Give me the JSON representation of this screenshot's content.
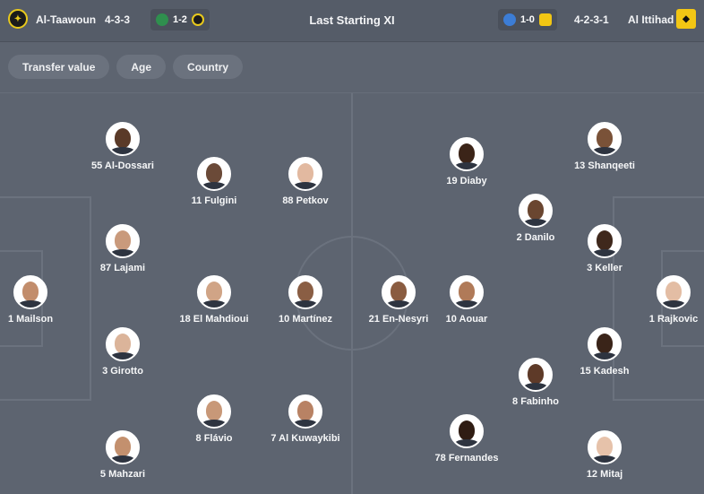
{
  "header": {
    "home_team": "Al-Taawoun",
    "home_formation": "4-3-3",
    "home_result": "1-2",
    "title": "Last Starting XI",
    "away_result": "1-0",
    "away_formation": "4-2-3-1",
    "away_team": "Al Ittihad"
  },
  "filters": [
    "Transfer value",
    "Age",
    "Country"
  ],
  "home_players": [
    {
      "label": "55 Al-Dossari",
      "skin": "#5a3a28"
    },
    {
      "label": "11 Fulgini",
      "skin": "#6b4a38"
    },
    {
      "label": "88 Petkov",
      "skin": "#e2b9a0"
    },
    {
      "label": "87 Lajami",
      "skin": "#c99a7c"
    },
    {
      "label": "1 Mailson",
      "skin": "#c28d6c"
    },
    {
      "label": "18 El Mahdioui",
      "skin": "#d0a486"
    },
    {
      "label": "10 Martínez",
      "skin": "#8a5e44"
    },
    {
      "label": "3 Girotto",
      "skin": "#dbb49a"
    },
    {
      "label": "8 Flávio",
      "skin": "#c89878"
    },
    {
      "label": "7 Al Kuwaykibi",
      "skin": "#b88264"
    },
    {
      "label": "5 Mahzari",
      "skin": "#c3906e"
    }
  ],
  "away_players": [
    {
      "label": "19 Diaby",
      "skin": "#3b2418"
    },
    {
      "label": "13 Shanqeeti",
      "skin": "#7a5238"
    },
    {
      "label": "2 Danilo",
      "skin": "#6a4630"
    },
    {
      "label": "3 Keller",
      "skin": "#3f281c"
    },
    {
      "label": "21 En-Nesyri",
      "skin": "#8a5c40"
    },
    {
      "label": "10 Aouar",
      "skin": "#b07a58"
    },
    {
      "label": "1 Rajkovic",
      "skin": "#e3bda4"
    },
    {
      "label": "15 Kadesh",
      "skin": "#3a2419"
    },
    {
      "label": "8 Fabinho",
      "skin": "#5e3a28"
    },
    {
      "label": "78 Fernandes",
      "skin": "#2f1c13"
    },
    {
      "label": "12 Mitaj",
      "skin": "#e6c2aa"
    }
  ],
  "colors": {
    "background": "#5d6470",
    "chip": "#6b727e",
    "pitch_lines": "#6b727e",
    "home_accent": "#e8c91c",
    "away_accent": "#f2c614"
  },
  "icons": {
    "home_badge": "al-taawoun-crest-icon",
    "away_badge": "al-ittihad-crest-icon",
    "home_opponent_badge": "opponent-crest-icon",
    "away_opponent_badge": "opponent-crest-icon"
  }
}
